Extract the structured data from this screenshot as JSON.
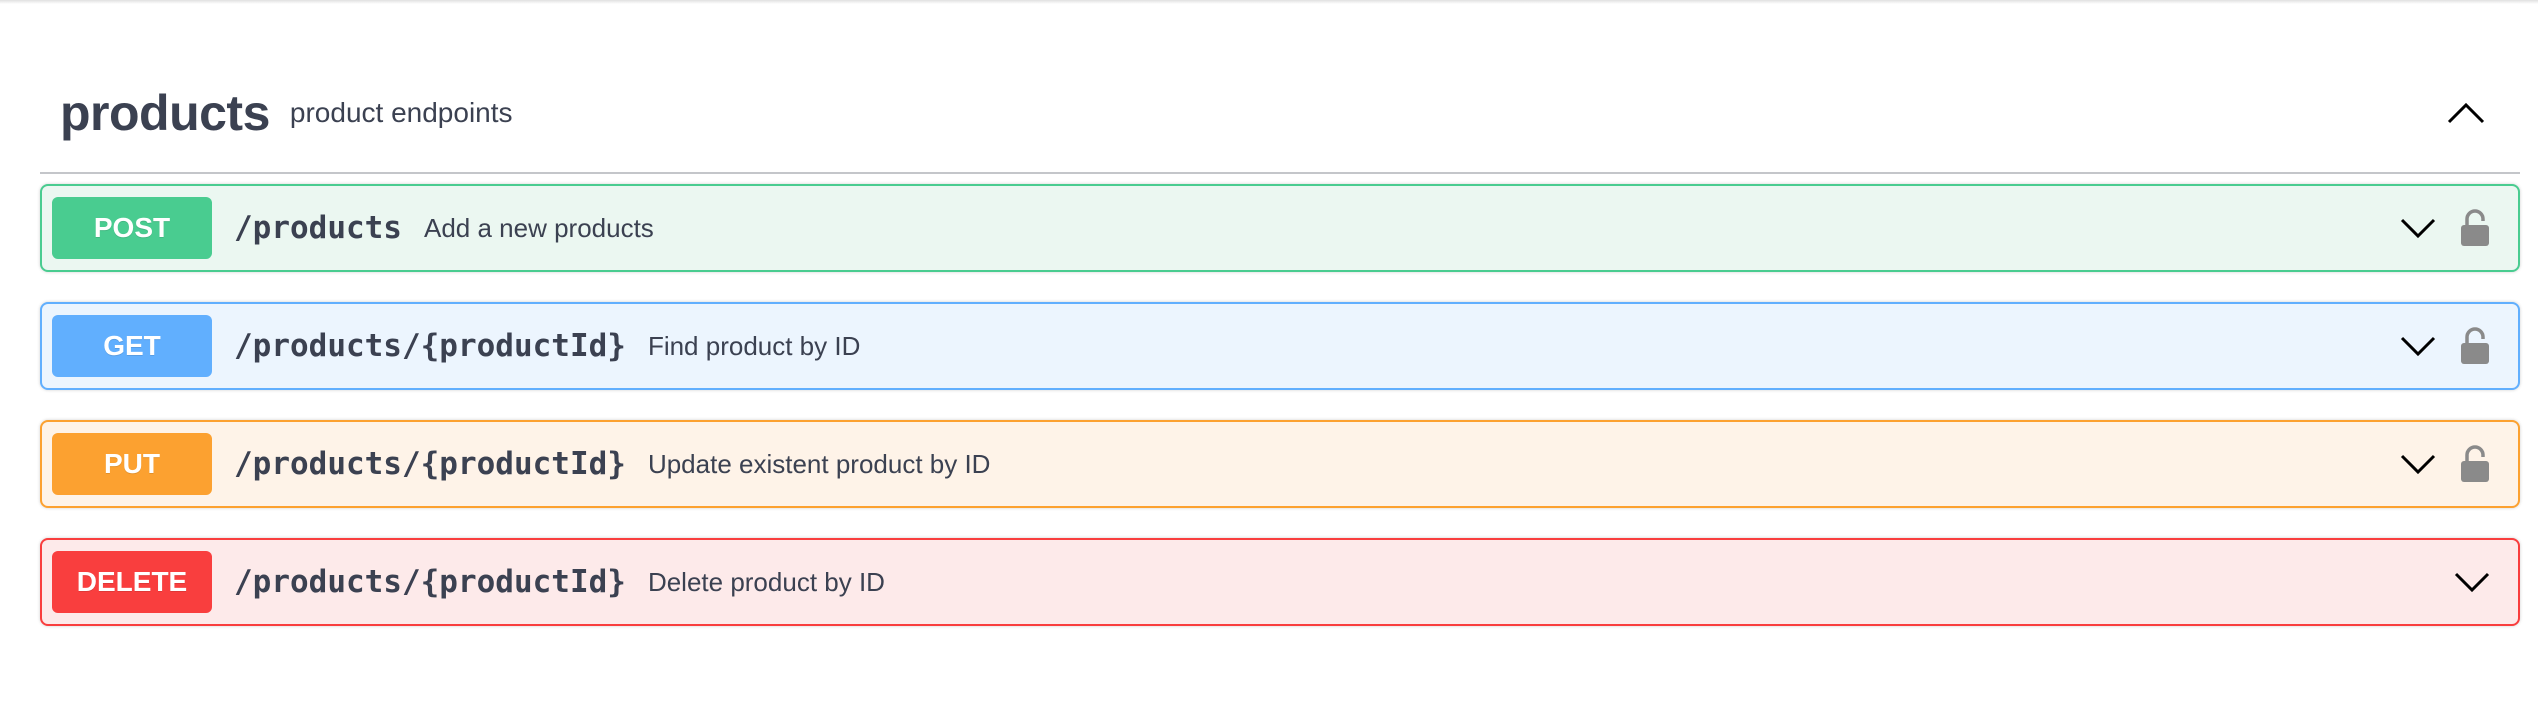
{
  "tag": {
    "name": "products",
    "description": "product endpoints",
    "toggle_icon": "chevron-up-icon"
  },
  "operations": [
    {
      "method": "POST",
      "path": "/products",
      "summary": "Add a new products",
      "locked": true,
      "color": "#49cc90"
    },
    {
      "method": "GET",
      "path": "/products/{productId}",
      "summary": "Find product by ID",
      "locked": true,
      "color": "#61affe"
    },
    {
      "method": "PUT",
      "path": "/products/{productId}",
      "summary": "Update existent product by ID",
      "locked": true,
      "color": "#fca130"
    },
    {
      "method": "DELETE",
      "path": "/products/{productId}",
      "summary": "Delete product by ID",
      "locked": false,
      "color": "#f93e3e"
    }
  ],
  "icons": {
    "expand": "chevron-down-icon",
    "auth": "lock-icon"
  }
}
